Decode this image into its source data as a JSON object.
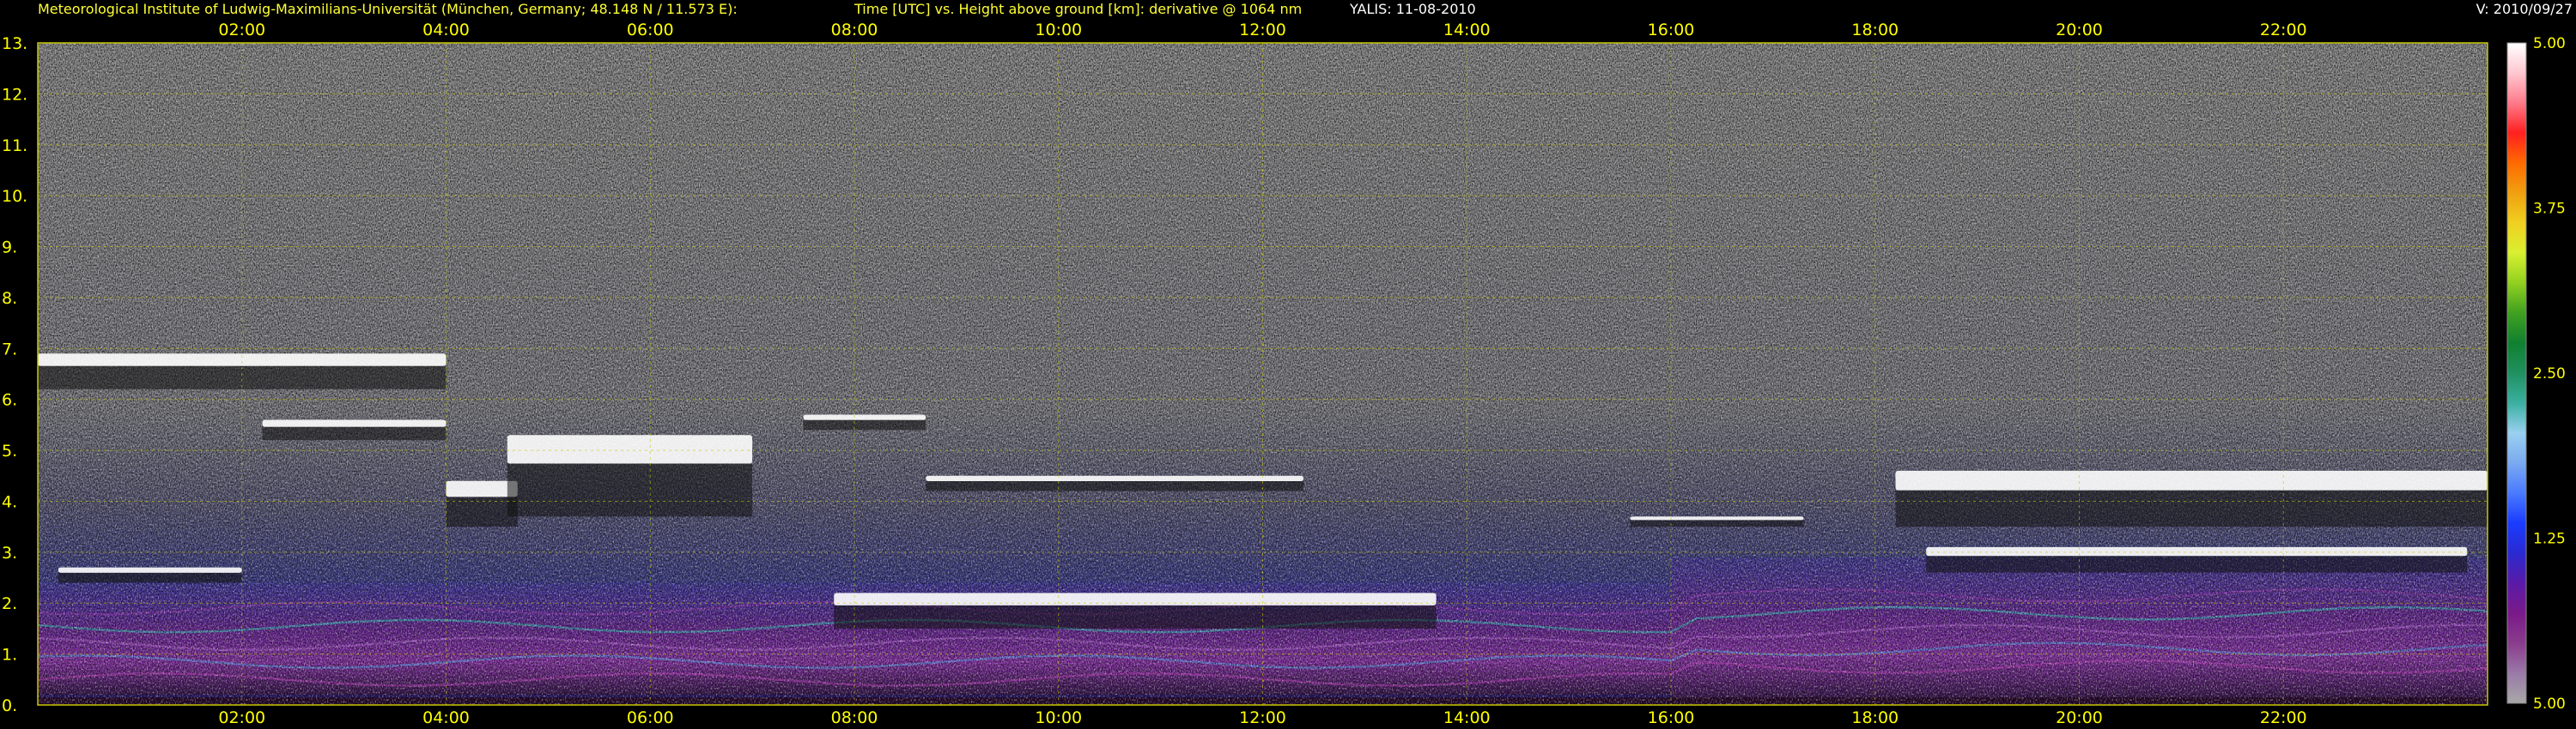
{
  "header": {
    "institute": "Meteorological Institute of Ludwig-Maximilians-Universität (München, Germany; 48.148 N / 11.573 E):",
    "axes": "Time [UTC] vs. Height above ground [km]: derivative @ 1064 nm",
    "station": "YALIS: 11-08-2010",
    "version": "V: 2010/09/27"
  },
  "colors": {
    "background": "#000000",
    "text": "#ffff00",
    "grid": "#c8c800",
    "colorbar": [
      "#a8a8a8",
      "#9a7aa8",
      "#8a3c8c",
      "#7a1a8a",
      "#5a1aa8",
      "#2a2ad0",
      "#1a3cff",
      "#4a7aff",
      "#7aaaf0",
      "#9ad0f0",
      "#3ab0a0",
      "#209060",
      "#108030",
      "#40a020",
      "#90d020",
      "#d8f030",
      "#f0d020",
      "#f0a010",
      "#ff6a00",
      "#ff2020",
      "#ff7a8a",
      "#ffc8d0",
      "#ffffff"
    ]
  },
  "chart_data": {
    "type": "heatmap",
    "title": "Time [UTC] vs. Height above ground [km]: derivative @ 1064 nm",
    "xlabel": "Time [UTC]",
    "ylabel": "Height above ground [km]",
    "xlim": [
      0.0,
      24.0
    ],
    "ylim": [
      0,
      13
    ],
    "x_ticks": [
      "02:00",
      "04:00",
      "06:00",
      "08:00",
      "10:00",
      "12:00",
      "14:00",
      "16:00",
      "18:00",
      "20:00",
      "22:00"
    ],
    "x_tick_values": [
      2,
      4,
      6,
      8,
      10,
      12,
      14,
      16,
      18,
      20,
      22
    ],
    "y_ticks": [
      "0.",
      "1.",
      "2.",
      "3.",
      "4.",
      "5.",
      "6.",
      "7.",
      "8.",
      "9.",
      "10.",
      "11.",
      "12.",
      "13."
    ],
    "y_tick_values": [
      0,
      1,
      2,
      3,
      4,
      5,
      6,
      7,
      8,
      9,
      10,
      11,
      12,
      13
    ],
    "grid": true,
    "colorbar": {
      "ticks": [
        "5.00",
        "3.75",
        "2.50",
        "1.25",
        "5.00"
      ],
      "position": "right"
    },
    "cloud_layers": [
      {
        "t": [
          0.0,
          4.0
        ],
        "h": [
          6.2,
          6.9
        ]
      },
      {
        "t": [
          2.2,
          4.0
        ],
        "h": [
          5.2,
          5.6
        ]
      },
      {
        "t": [
          4.0,
          4.7
        ],
        "h": [
          3.5,
          4.4
        ]
      },
      {
        "t": [
          4.6,
          7.0
        ],
        "h": [
          3.7,
          5.3
        ]
      },
      {
        "t": [
          7.5,
          8.7
        ],
        "h": [
          5.4,
          5.7
        ]
      },
      {
        "t": [
          8.7,
          12.4
        ],
        "h": [
          4.2,
          4.5
        ]
      },
      {
        "t": [
          15.6,
          17.3
        ],
        "h": [
          3.5,
          3.7
        ]
      },
      {
        "t": [
          18.2,
          24.0
        ],
        "h": [
          3.5,
          4.6
        ]
      },
      {
        "t": [
          18.5,
          23.8
        ],
        "h": [
          2.6,
          3.1
        ]
      },
      {
        "t": [
          0.2,
          2.0
        ],
        "h": [
          2.4,
          2.7
        ]
      },
      {
        "t": [
          7.8,
          13.7
        ],
        "h": [
          1.5,
          2.2
        ]
      }
    ],
    "aerosol_layers": [
      {
        "t": [
          0.0,
          16.0
        ],
        "h": [
          0.2,
          2.4
        ]
      },
      {
        "t": [
          16.0,
          24.0
        ],
        "h": [
          0.1,
          2.9
        ]
      }
    ]
  }
}
